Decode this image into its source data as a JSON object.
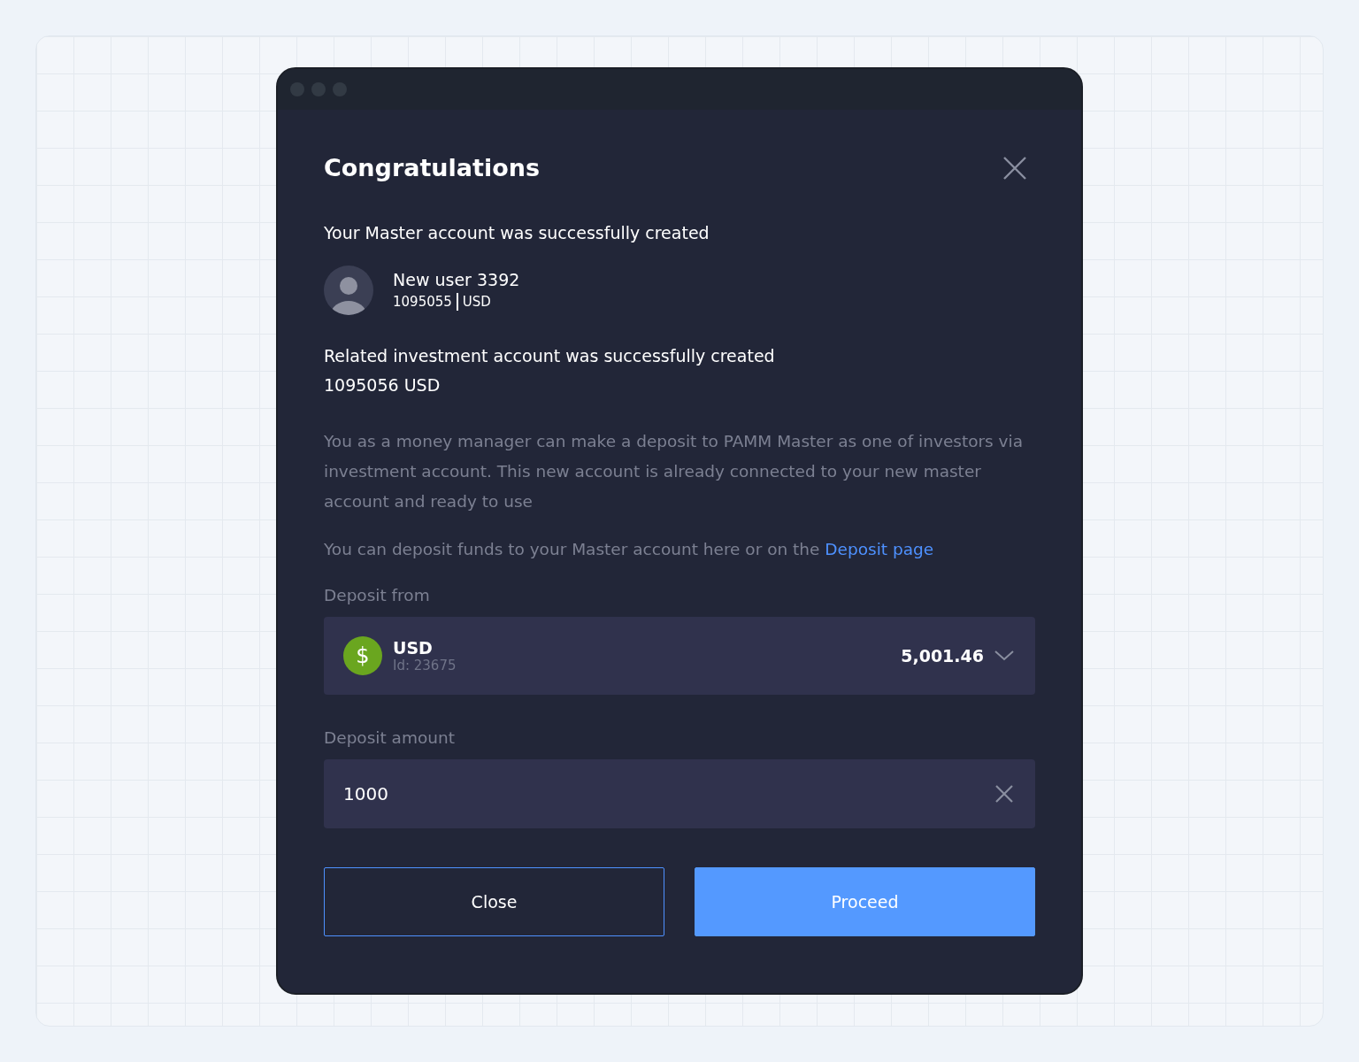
{
  "dialog": {
    "title": "Congratulations",
    "master_message": "Your Master account was successfully created",
    "user": {
      "name": "New user 3392",
      "account": "1095055",
      "currency": "USD"
    },
    "related_message": "Related investment account was successfully created",
    "related_account": "1095056 USD",
    "info": "You as a money manager can make a deposit to PAMM Master as one of investors via investment account. This new account is already connected to your new master account and ready to use",
    "deposit_note": "You can deposit funds to your Master account here or on the",
    "deposit_link": "Deposit page",
    "deposit_from": {
      "label": "Deposit from",
      "symbol": "$",
      "currency": "USD",
      "id": "Id: 23675",
      "balance": "5,001.46"
    },
    "deposit_amount": {
      "label": "Deposit amount",
      "value": "1000"
    },
    "buttons": [
      {
        "label": "Close",
        "kind": "secondary"
      },
      {
        "label": "Proceed",
        "kind": "primary"
      }
    ]
  }
}
